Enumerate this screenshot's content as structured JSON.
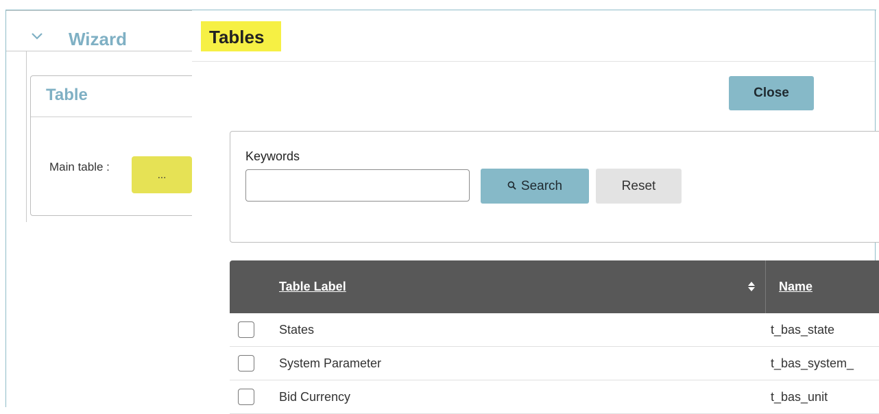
{
  "wizard": {
    "title": "Wizard",
    "card_title": "Table",
    "main_table_label": "Main table :",
    "browse_button_label": "..."
  },
  "modal": {
    "title": "Tables",
    "close_label": "Close",
    "search": {
      "keywords_label": "Keywords",
      "keywords_value": "",
      "search_label": "Search",
      "reset_label": "Reset"
    },
    "grid": {
      "columns": [
        "Table Label",
        "Name"
      ],
      "rows": [
        {
          "label": "States",
          "name": "t_bas_state"
        },
        {
          "label": "System Parameter",
          "name": "t_bas_system_"
        },
        {
          "label": "Bid Currency",
          "name": "t_bas_unit"
        }
      ]
    }
  },
  "colors": {
    "accent": "#86b9c8",
    "highlight": "#f6f044",
    "header_bg": "#585858",
    "title_blue": "#7fb0c4"
  },
  "icons": [
    "chevron-down-icon",
    "search-icon",
    "sort-icon"
  ]
}
